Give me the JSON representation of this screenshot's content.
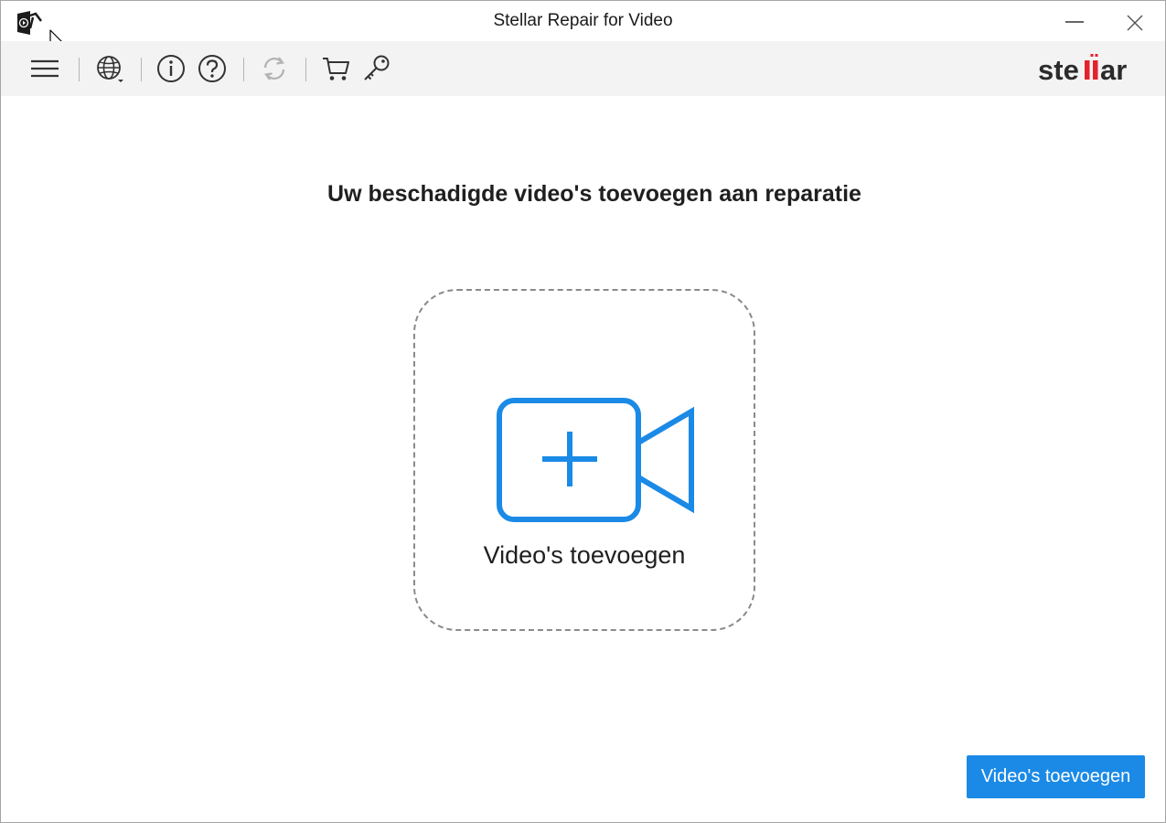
{
  "window": {
    "title": "Stellar Repair for Video"
  },
  "toolbar": {
    "icons": [
      "menu-icon",
      "globe-icon",
      "info-icon",
      "help-icon",
      "refresh-icon",
      "cart-icon",
      "key-icon"
    ],
    "brand_logo_text": "stellar"
  },
  "main": {
    "heading": "Uw beschadigde video's toevoegen aan reparatie",
    "drop_zone_label": "Video's toevoegen"
  },
  "footer": {
    "add_button_label": "Video's toevoegen"
  },
  "colors": {
    "accent_blue": "#1a8ae6",
    "brand_red": "#e4222b",
    "toolbar_bg": "#f3f3f3"
  }
}
